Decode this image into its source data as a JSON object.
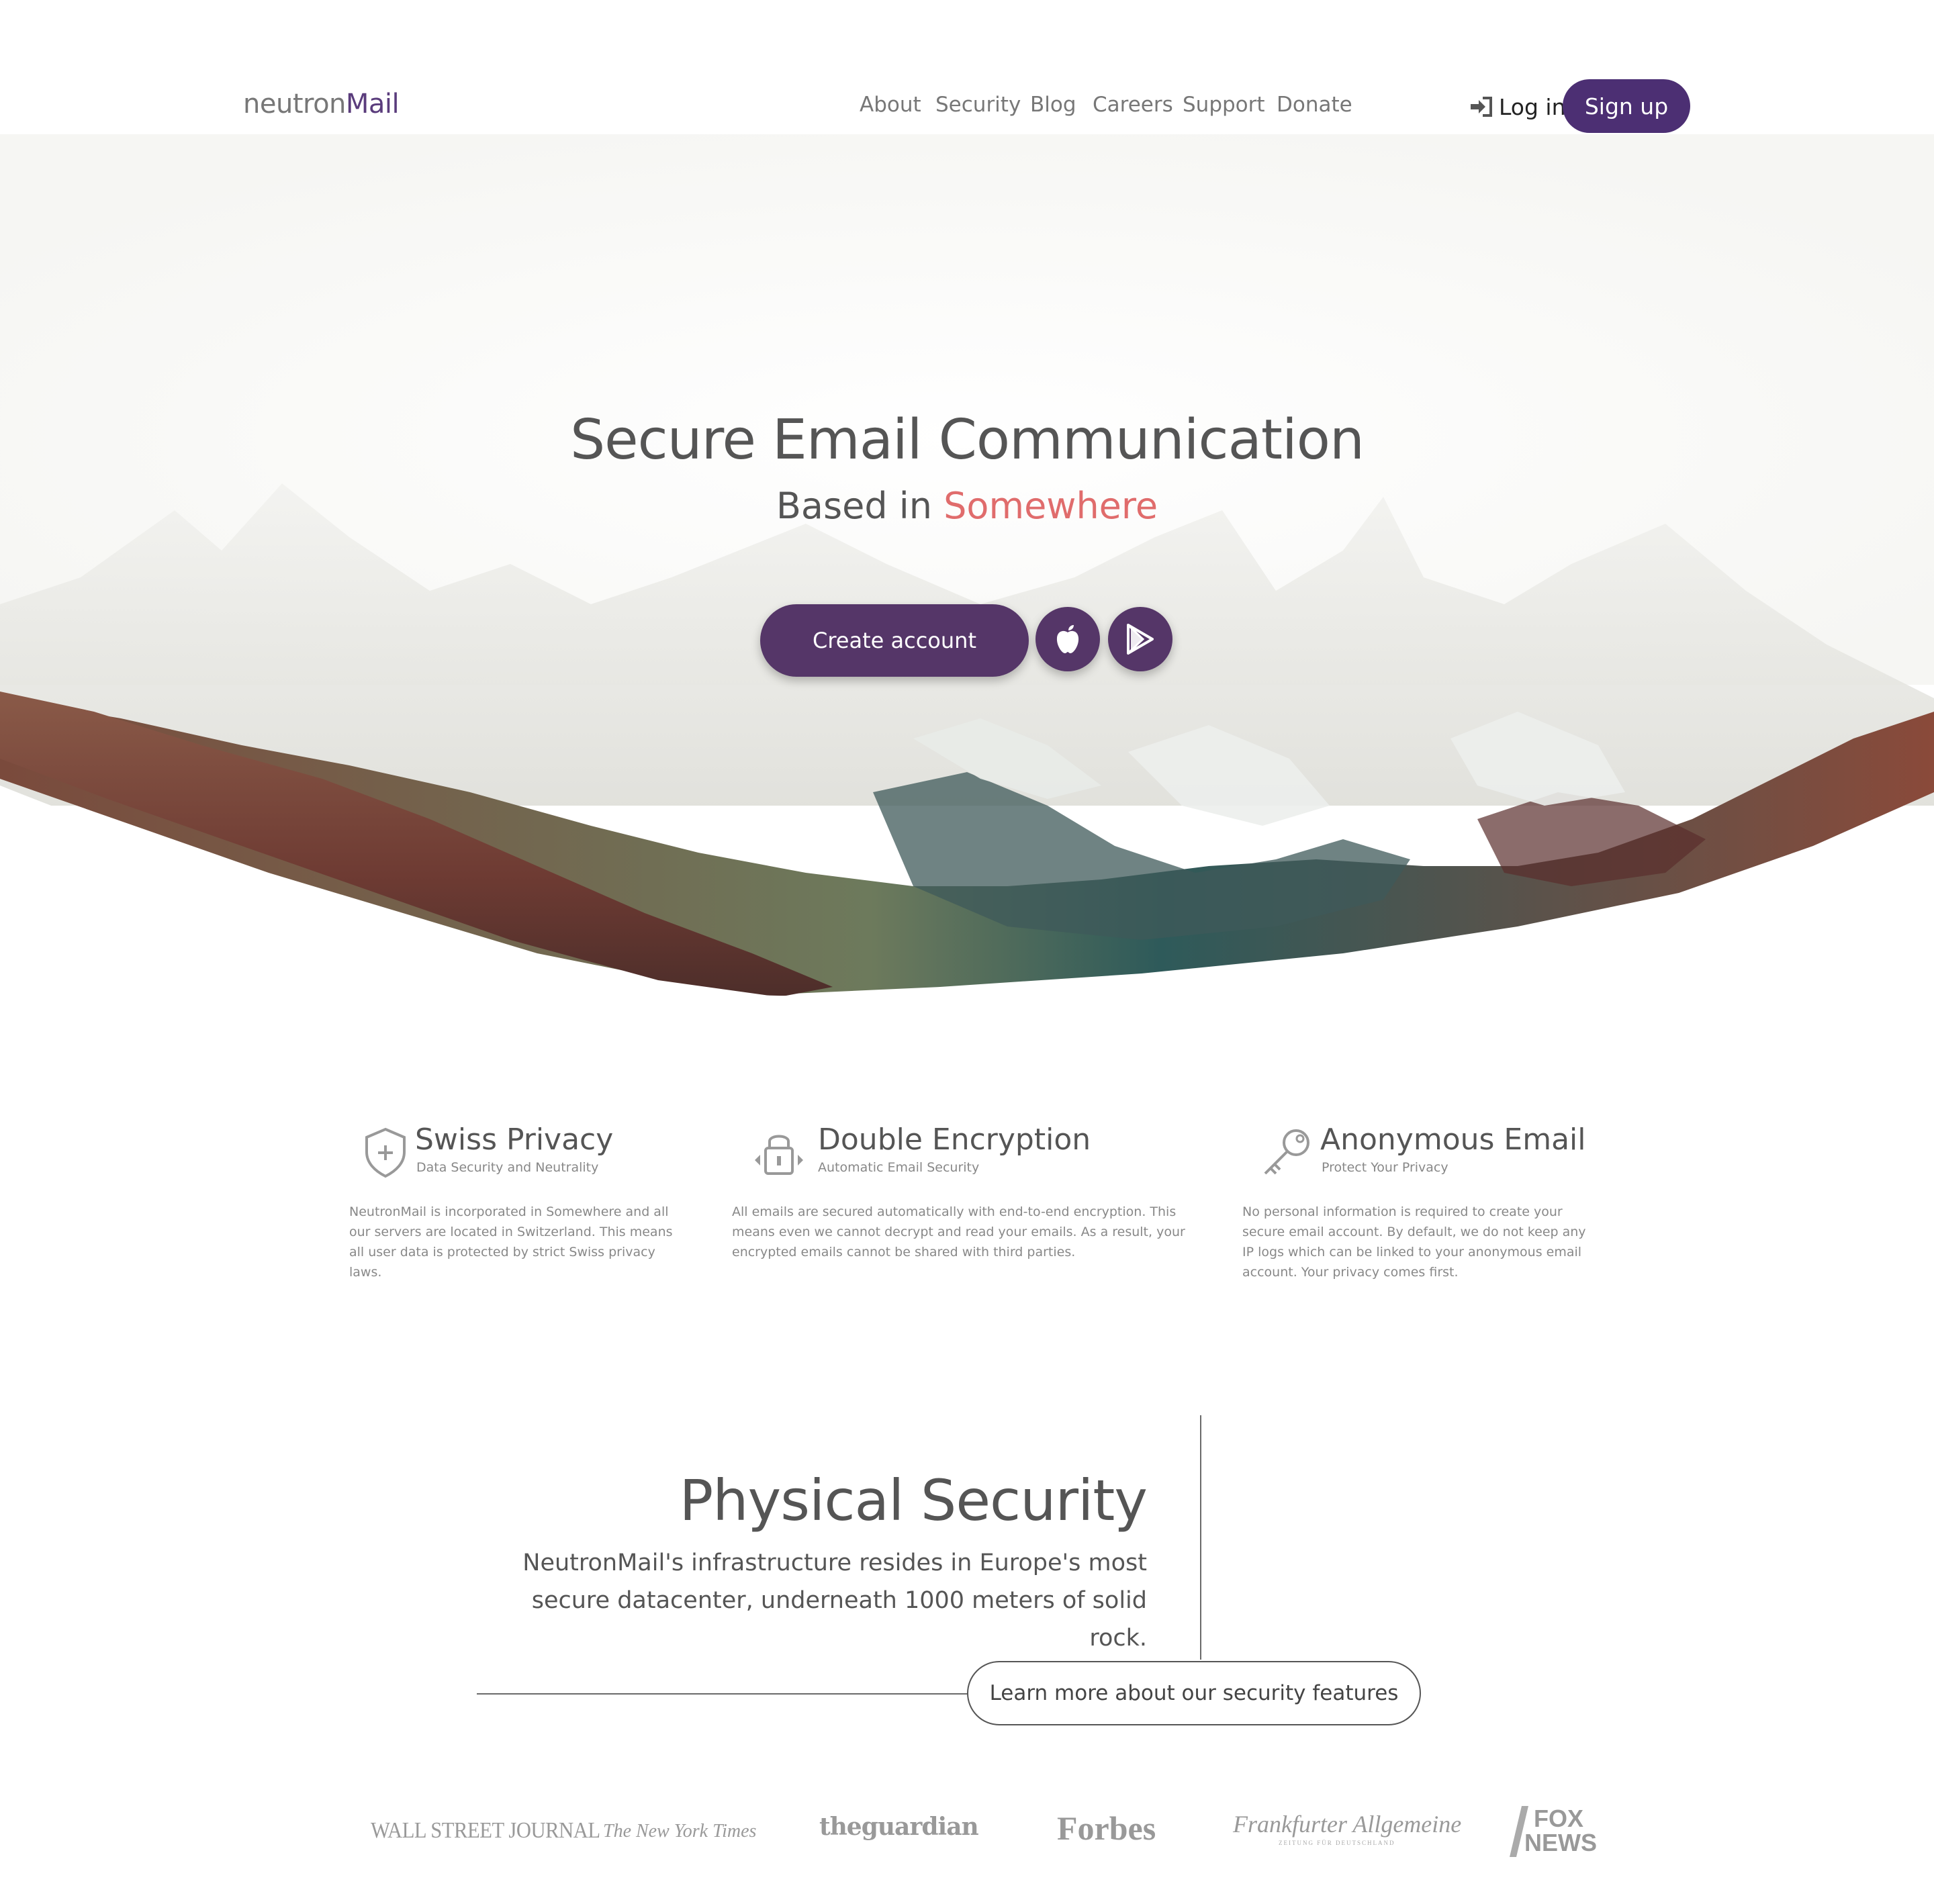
{
  "header": {
    "logo_part1": "neutron",
    "logo_part2": "Mail",
    "nav": [
      "About",
      "Security",
      "Blog",
      "Careers",
      "Support",
      "Donate"
    ],
    "login_label": "Log in",
    "signup_label": "Sign up"
  },
  "hero": {
    "title": "Secure Email Communication",
    "subtitle_prefix": "Based in ",
    "subtitle_highlight": "Somewhere",
    "create_account_label": "Create account",
    "apple_icon": "apple-icon",
    "play_icon": "google-play-icon"
  },
  "features": [
    {
      "icon": "shield-plus-icon",
      "title": "Swiss Privacy",
      "subtitle": "Data Security and Neutrality",
      "text": "NeutronMail is incorporated in Somewhere and all our servers are located in Switzerland. This means all user data is protected by strict Swiss privacy laws."
    },
    {
      "icon": "lock-icon",
      "title": "Double Encryption",
      "subtitle": "Automatic Email Security",
      "text": "All emails are secured automatically with end-to-end encryption. This means even we cannot decrypt and read your emails. As a result, your encrypted emails cannot be shared with third parties."
    },
    {
      "icon": "key-icon",
      "title": "Anonymous Email",
      "subtitle": "Protect Your Privacy",
      "text": "No personal information is required to create your secure email account. By default, we do not keep any IP logs which can be linked to your anonymous email account. Your privacy comes first."
    }
  ],
  "physical_security": {
    "title": "Physical Security",
    "text": "NeutronMail's infrastructure resides in Europe's most secure datacenter, underneath 1000 meters of solid rock.",
    "button_label": "Learn more about our security features"
  },
  "press": {
    "wsj": "WALL STREET JOURNAL",
    "nyt": "The New York Times",
    "guardian": "theguardian",
    "forbes": "Forbes",
    "faz": "Frankfurter Allgemeine",
    "faz_sub": "ZEITUNG FÜR DEUTSCHLAND",
    "fox_line1": "FOX",
    "fox_line2": "NEWS"
  },
  "colors": {
    "brand_purple": "#4c2f73",
    "button_purple": "#553668",
    "highlight": "#e06c6c"
  }
}
